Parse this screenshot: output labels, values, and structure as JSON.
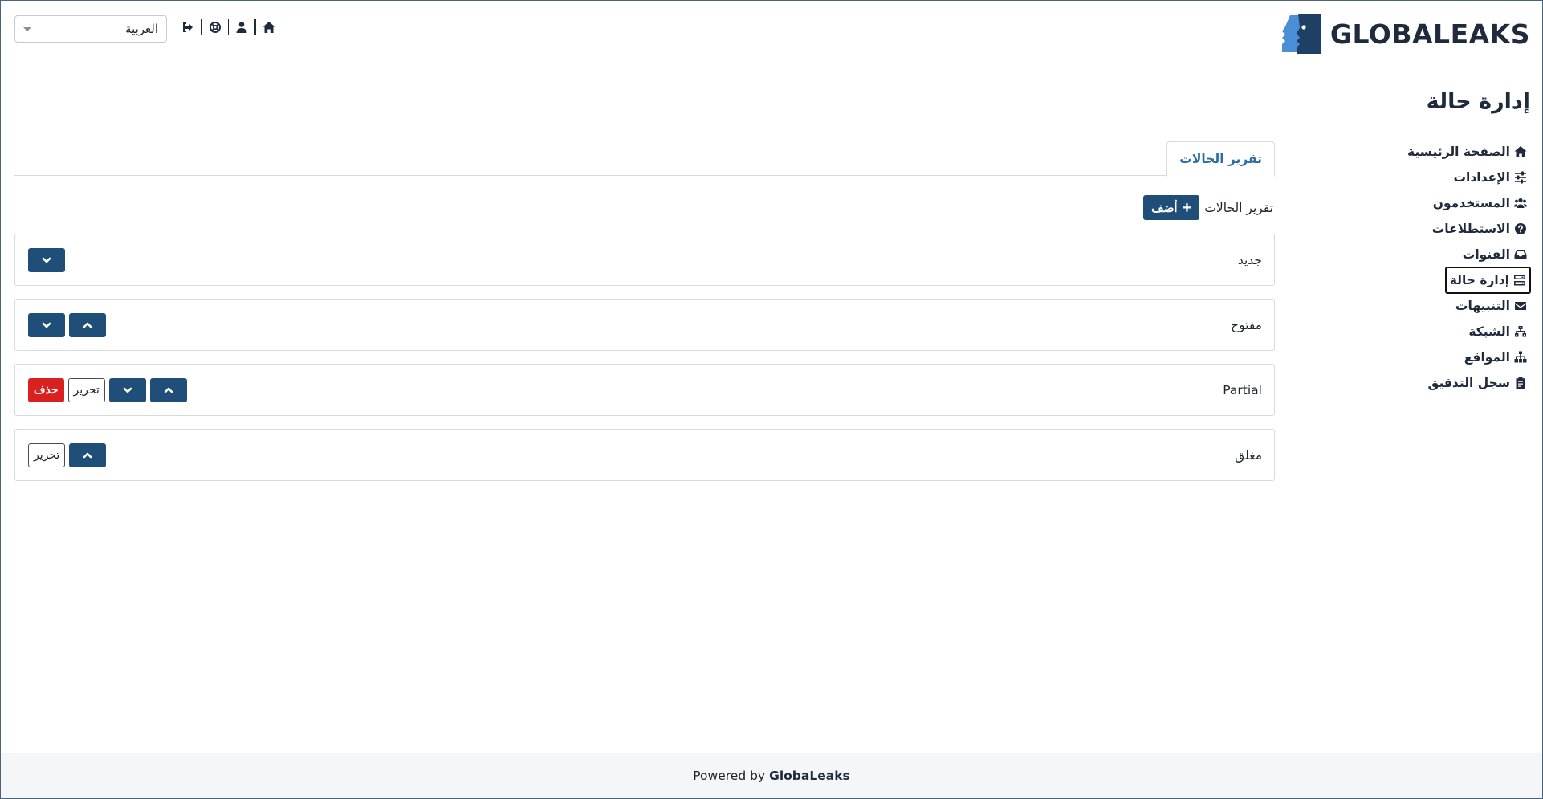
{
  "app": {
    "logo_text": "GLOBALEAKS",
    "logo_icon": "globaleaks-logo-icon"
  },
  "language_select": {
    "value": "العربية"
  },
  "top_nav": {
    "items": [
      {
        "name": "home-icon"
      },
      {
        "name": "user-icon"
      },
      {
        "name": "support-icon"
      },
      {
        "name": "logout-icon"
      }
    ]
  },
  "page": {
    "title": "إدارة حالة"
  },
  "sidebar": {
    "items": [
      {
        "label": "الصفحة الرئيسية",
        "icon": "home-icon"
      },
      {
        "label": "الإعدادات",
        "icon": "sliders-icon"
      },
      {
        "label": "المستخدمون",
        "icon": "users-icon"
      },
      {
        "label": "الاستطلاعات",
        "icon": "question-icon"
      },
      {
        "label": "القنوات",
        "icon": "inbox-icon"
      },
      {
        "label": "إدارة حالة",
        "icon": "server-icon",
        "active": true
      },
      {
        "label": "التنبيهات",
        "icon": "envelope-icon"
      },
      {
        "label": "الشبكة",
        "icon": "network-icon"
      },
      {
        "label": "المواقع",
        "icon": "sitemap-icon"
      },
      {
        "label": "سجل التدقيق",
        "icon": "clipboard-icon"
      }
    ]
  },
  "tabs": [
    {
      "label": "تقرير الحالات",
      "active": true
    }
  ],
  "section": {
    "label": "تقرير الحالات",
    "add_button": "أضف"
  },
  "statuses": [
    {
      "name": "جديد"
    },
    {
      "name": "مفتوح"
    },
    {
      "name": "Partial",
      "edit_label": "تحرير",
      "delete_label": "حذف"
    },
    {
      "name": "مغلق",
      "edit_label": "تحرير"
    }
  ],
  "footer": {
    "prefix": "Powered by",
    "brand": "GlobaLeaks"
  },
  "colors": {
    "primary": "#1f4e79",
    "danger": "#d9211f",
    "tab_active": "#2e6da4"
  }
}
